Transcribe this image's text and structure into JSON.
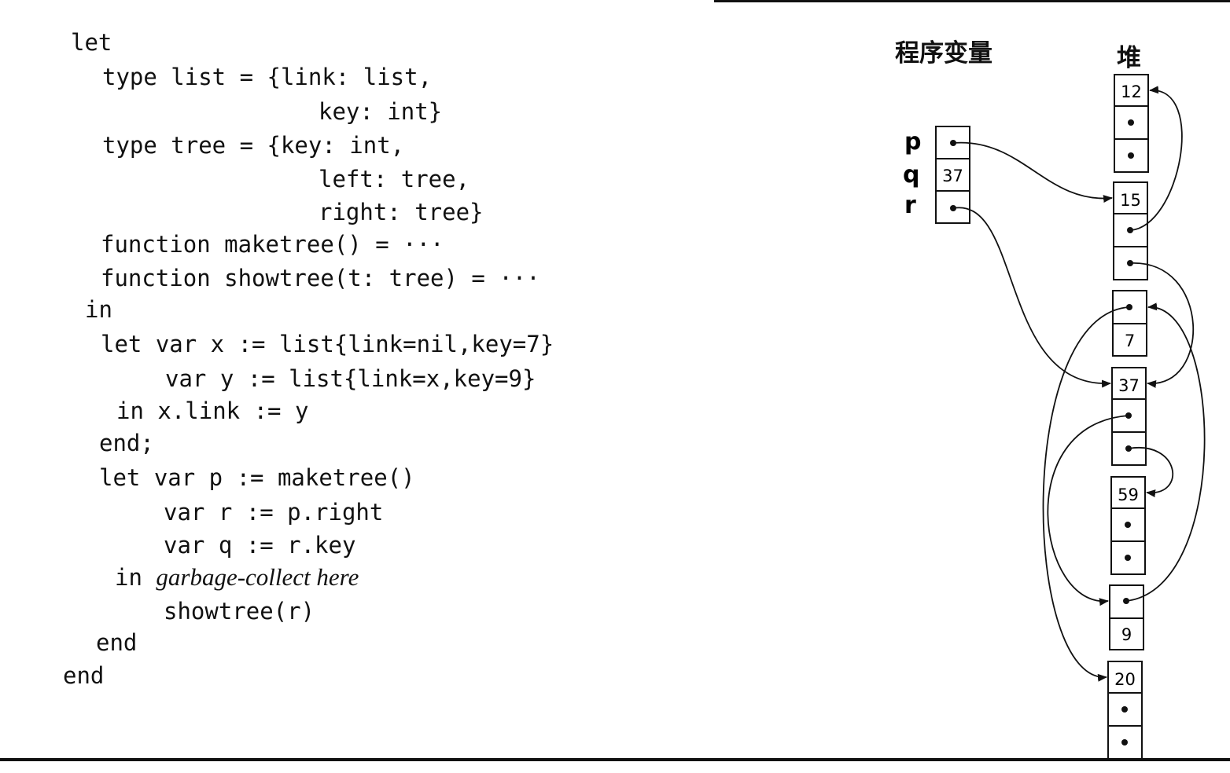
{
  "code": [
    {
      "text": "let"
    },
    {
      "text": "type list = {link: list,"
    },
    {
      "text": "key: int}"
    },
    {
      "text": "type tree = {key: int,"
    },
    {
      "text": "left: tree,"
    },
    {
      "text": "right: tree}"
    },
    {
      "text": "function maketree() = ···"
    },
    {
      "text": "function showtree(t: tree) = ···"
    },
    {
      "text": "in"
    },
    {
      "text": "let var x := list{link=nil,key=7}"
    },
    {
      "text": "var y := list{link=x,key=9}"
    },
    {
      "text": "in x.link := y"
    },
    {
      "text": "end;"
    },
    {
      "text": "let var p := maketree()"
    },
    {
      "text": "var r := p.right"
    },
    {
      "text": "var q := r.key"
    },
    {
      "text": "in ",
      "note": "garbage-collect here"
    },
    {
      "text": "showtree(r)"
    },
    {
      "text": "end"
    },
    {
      "text": "end"
    }
  ],
  "diagram": {
    "program_vars_title": "程序变量",
    "heap_title": "堆",
    "variables": [
      {
        "name": "p",
        "value": ""
      },
      {
        "name": "q",
        "value": "37"
      },
      {
        "name": "r",
        "value": ""
      }
    ],
    "heap_records": [
      {
        "key": "12"
      },
      {
        "key": "15"
      },
      {
        "key": "7"
      },
      {
        "key": "37"
      },
      {
        "key": "59"
      },
      {
        "key": "9"
      },
      {
        "key": "20"
      }
    ]
  }
}
